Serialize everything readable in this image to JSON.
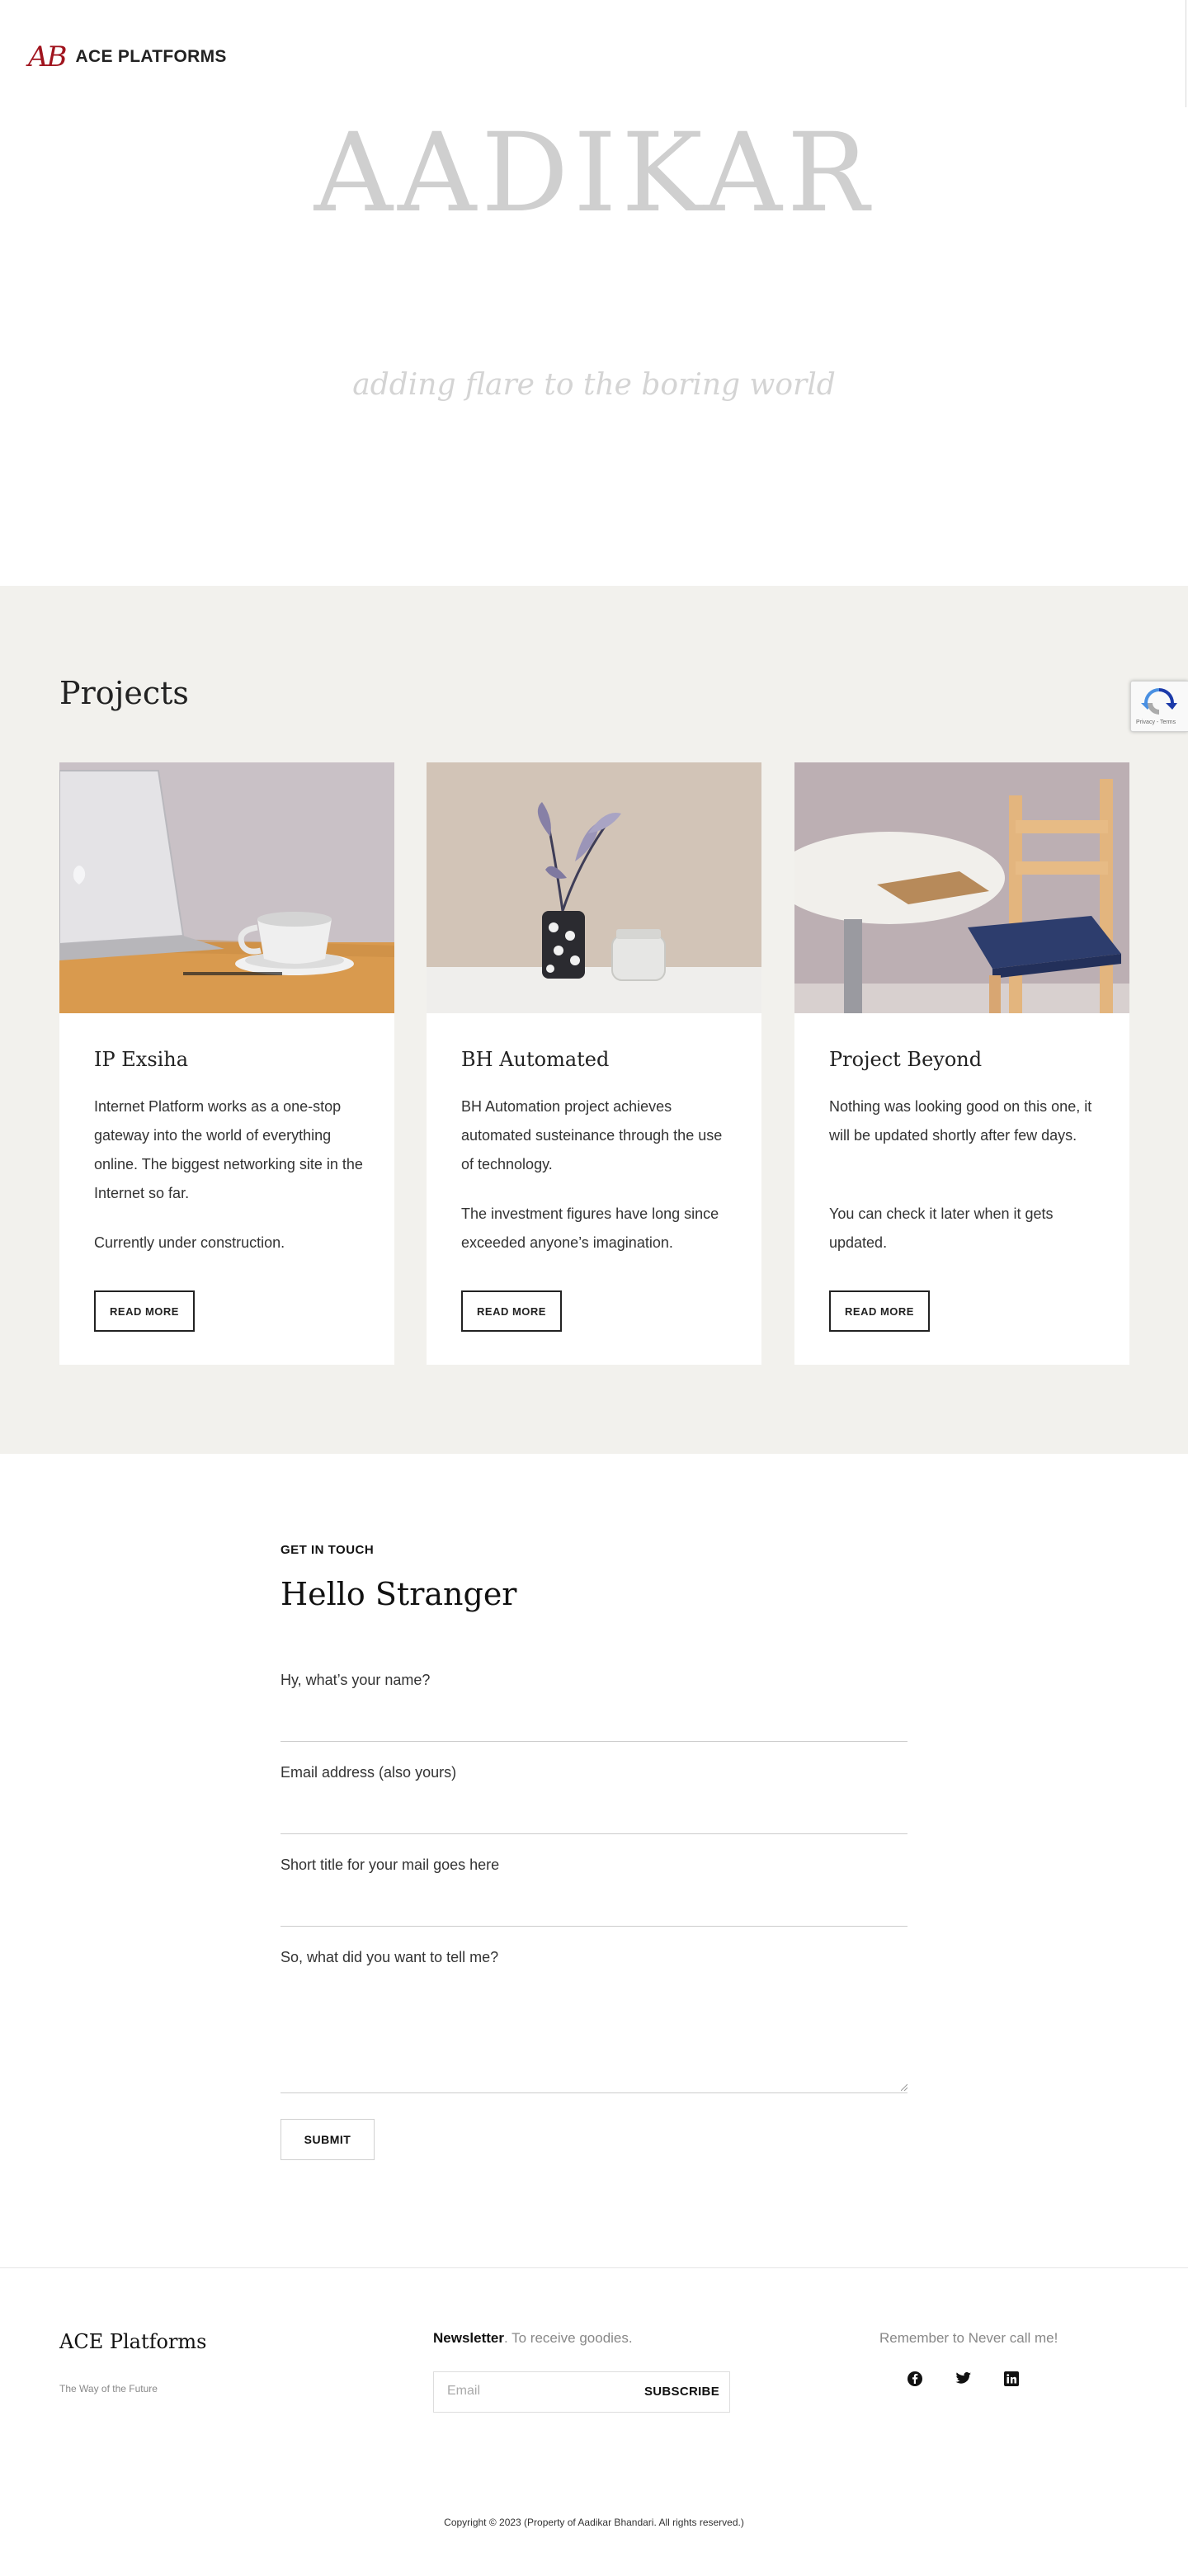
{
  "header": {
    "logo_mark": "AB",
    "brand": "ACE PLATFORMS"
  },
  "hero": {
    "title": "AADIKAR",
    "subtitle": "adding flare to the boring world"
  },
  "projects": {
    "title": "Projects",
    "recaptcha_text": "Privacy - Terms",
    "cards": [
      {
        "title": "IP Exsiha",
        "p1": "Internet Platform works as a one-stop gateway into the world of everything online. The biggest networking site in the Internet so far.",
        "p2": "Currently under construction.",
        "button": "READ MORE",
        "image": "laptop-coffee-photo"
      },
      {
        "title": "BH Automated",
        "p1": "BH Automation project achieves automated susteinance through the use of technology.",
        "p2": "The investment figures have long since exceeded anyone’s imagination.",
        "button": "READ MORE",
        "image": "vase-jar-photo"
      },
      {
        "title": "Project Beyond",
        "p1": "Nothing was looking good on this one, it will be updated shortly after few days.",
        "p2": "You can check it later when it gets updated.",
        "button": "READ MORE",
        "image": "table-chair-photo"
      }
    ]
  },
  "contact": {
    "eyebrow": "GET IN TOUCH",
    "title": "Hello Stranger",
    "fields": [
      {
        "label": "Hy, what’s your name?",
        "value": ""
      },
      {
        "label": "Email address (also yours)",
        "value": ""
      },
      {
        "label": "Short title for your mail goes here",
        "value": ""
      },
      {
        "label": "So, what did you want to tell me?",
        "value": ""
      }
    ],
    "submit": "SUBMIT"
  },
  "footer": {
    "brand": "ACE Platforms",
    "tagline": "The Way of the Future",
    "newsletter_bold": "Newsletter",
    "newsletter_rest": ". To receive goodies.",
    "email_placeholder": "Email",
    "subscribe": "SUBSCRIBE",
    "social_label": "Remember to Never call me!",
    "social_icons": [
      "facebook-icon",
      "twitter-icon",
      "linkedin-icon"
    ],
    "copyright": "Copyright © 2023 (Property of Aadikar Bhandari. All rights reserved.)"
  },
  "colors": {
    "logo_red": "#a0141e",
    "projects_bg": "#f2f1ed",
    "hero_text": "#cfcfcf"
  }
}
